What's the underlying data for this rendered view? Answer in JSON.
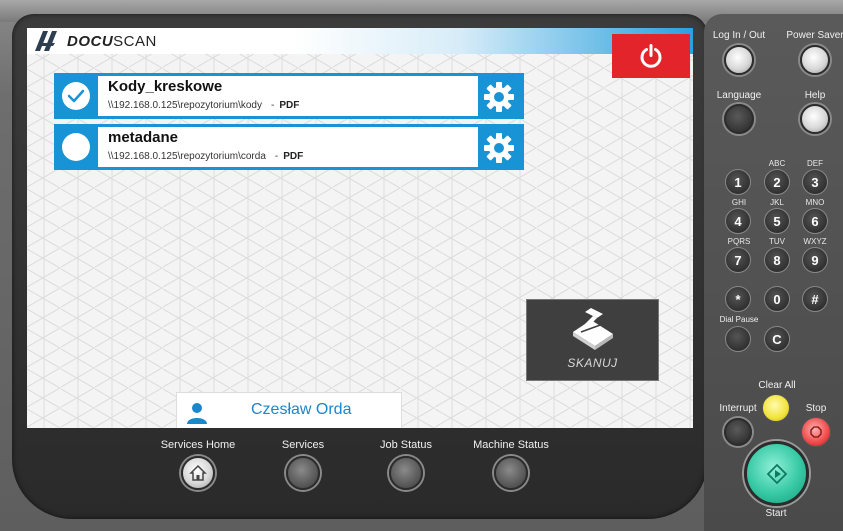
{
  "app": {
    "logo_bold": "DOCU",
    "logo_light": "SCAN"
  },
  "jobs": [
    {
      "name": "Kody_kreskowe",
      "path": "\\\\192.168.0.125\\repozytorium\\kody",
      "separator": "-",
      "format": "PDF",
      "selected": true
    },
    {
      "name": "metadane",
      "path": "\\\\192.168.0.125\\repozytorium\\corda",
      "separator": "-",
      "format": "PDF",
      "selected": false
    }
  ],
  "scan_button": {
    "label": "SKANUJ"
  },
  "user": {
    "name": "Czesław Orda"
  },
  "hard_buttons": {
    "services_home": "Services Home",
    "services": "Services",
    "job_status": "Job Status",
    "machine_status": "Machine Status"
  },
  "keypad": {
    "log_in_out": "Log In / Out",
    "power_saver": "Power Saver",
    "language": "Language",
    "help": "Help",
    "keys": [
      {
        "digit": "1",
        "letters": ""
      },
      {
        "digit": "2",
        "letters": "ABC"
      },
      {
        "digit": "3",
        "letters": "DEF"
      },
      {
        "digit": "4",
        "letters": "GHI"
      },
      {
        "digit": "5",
        "letters": "JKL"
      },
      {
        "digit": "6",
        "letters": "MNO"
      },
      {
        "digit": "7",
        "letters": "PQRS"
      },
      {
        "digit": "8",
        "letters": "TUV"
      },
      {
        "digit": "9",
        "letters": "WXYZ"
      },
      {
        "digit": "*",
        "letters": ""
      },
      {
        "digit": "0",
        "letters": ""
      },
      {
        "digit": "#",
        "letters": ""
      }
    ],
    "dial_pause": "Dial Pause",
    "clear_key": "C",
    "clear_all": "Clear All",
    "interrupt": "Interrupt",
    "stop": "Stop",
    "start": "Start"
  },
  "colors": {
    "accent_blue": "#1894d6",
    "power_red": "#e4242b",
    "user_blue": "#1a86cc",
    "start_green": "#37c9a4",
    "clear_all_yellow": "#f2e33a",
    "stop_red": "#f04848"
  }
}
